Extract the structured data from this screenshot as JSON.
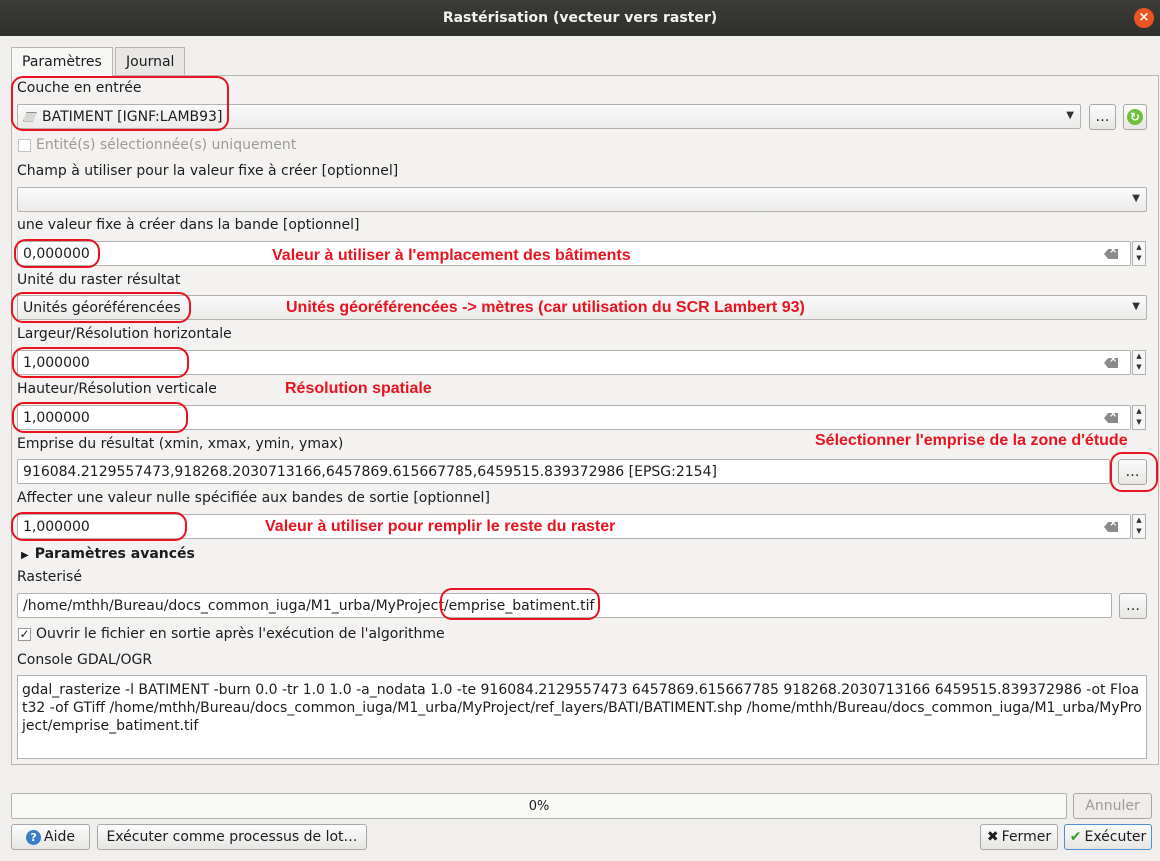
{
  "window": {
    "title": "Rastérisation (vecteur vers raster)"
  },
  "tabs": [
    "Paramètres",
    "Journal"
  ],
  "input_layer": {
    "label": "Couche en entrée",
    "value": "BATIMENT [IGNF:LAMB93]",
    "browse": "…",
    "selected_only": "Entité(s) sélectionnée(s) uniquement"
  },
  "burn_field": {
    "label": "Champ à utiliser pour la valeur fixe à créer [optionnel]",
    "value": ""
  },
  "burn_value": {
    "label": "une valeur fixe à créer dans la bande [optionnel]",
    "value": "0,000000"
  },
  "units": {
    "label": "Unité du raster résultat",
    "value": "Unités géoréférencées"
  },
  "width": {
    "label": "Largeur/Résolution horizontale",
    "value": "1,000000"
  },
  "height": {
    "label": "Hauteur/Résolution verticale",
    "value": "1,000000"
  },
  "extent": {
    "label": "Emprise du résultat (xmin, xmax, ymin, ymax)",
    "value": "916084.2129557473,918268.2030713166,6457869.615667785,6459515.839372986 [EPSG:2154]",
    "browse": "…"
  },
  "nodata": {
    "label": "Affecter une valeur nulle spécifiée aux bandes de sortie [optionnel]",
    "value": "1,000000"
  },
  "advanced": {
    "label": "Paramètres avancés"
  },
  "output": {
    "label": "Rasterisé",
    "value": "/home/mthh/Bureau/docs_common_iuga/M1_urba/MyProject/emprise_batiment.tif",
    "browse": "…",
    "open_after": "Ouvrir le fichier en sortie après l'exécution de l'algorithme"
  },
  "console": {
    "label": "Console GDAL/OGR",
    "text": "gdal_rasterize -l BATIMENT -burn 0.0 -tr 1.0 1.0 -a_nodata 1.0 -te 916084.2129557473 6457869.615667785 918268.2030713166 6459515.839372986 -ot Float32 -of GTiff /home/mthh/Bureau/docs_common_iuga/M1_urba/MyProject/ref_layers/BATI/BATIMENT.shp /home/mthh/Bureau/docs_common_iuga/M1_urba/MyProject/emprise_batiment.tif"
  },
  "progress": {
    "value": 0,
    "text": "0%"
  },
  "buttons": {
    "cancel": "Annuler",
    "help": "Aide",
    "batch": "Exécuter comme processus de lot…",
    "close": "Fermer",
    "run": "Exécuter"
  },
  "annotations": {
    "burn": "Valeur à utiliser à l'emplacement des bâtiments",
    "units": "Unités géoréférencées -> mètres (car utilisation du SCR Lambert 93)",
    "resolution": "Résolution spatiale",
    "extent": "Sélectionner l'emprise de la zone d'étude",
    "nodata": "Valeur à utiliser pour remplir le reste du raster",
    "color": "#e8131f"
  },
  "icons": [
    "close-icon",
    "layer-icon",
    "refresh-icon",
    "chevron-down-icon",
    "clear-icon",
    "expand-icon",
    "help-icon",
    "close-x-icon",
    "check-icon"
  ]
}
